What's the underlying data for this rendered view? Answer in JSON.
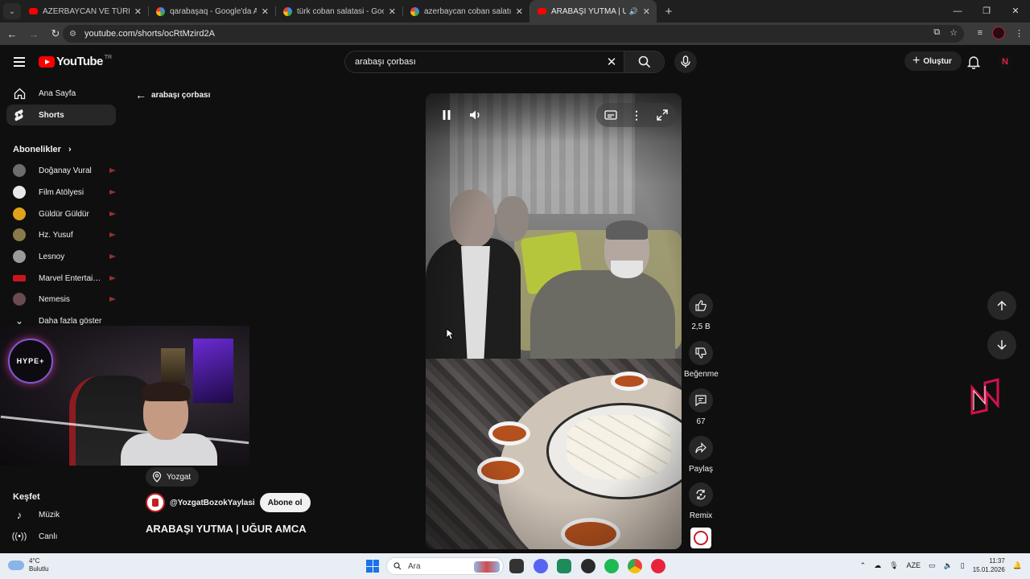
{
  "browser": {
    "tabs": [
      {
        "title": "AZERBAYCAN VE TÜRKİYE YEMEK",
        "favicon": "youtube"
      },
      {
        "title": "qarabaşaq - Google'da Ara",
        "favicon": "google"
      },
      {
        "title": "türk coban salatasi - Google'da",
        "favicon": "google"
      },
      {
        "title": "azerbaycan coban salatı - Google",
        "favicon": "google"
      },
      {
        "title": "ARABAŞI YUTMA | UĞUR AMCA",
        "favicon": "youtube",
        "active": true
      }
    ],
    "url": "youtube.com/shorts/ocRtMzird2A"
  },
  "header": {
    "logo_text": "YouTube",
    "country_code": "TR",
    "search_query": "arabaşı çorbası",
    "create_label": "Oluştur"
  },
  "sidebar": {
    "nav": [
      {
        "label": "Ana Sayfa",
        "icon": "home-icon"
      },
      {
        "label": "Shorts",
        "icon": "shorts-icon",
        "selected": true
      }
    ],
    "subscriptions_title": "Abonelikler",
    "subscriptions": [
      {
        "name": "Doğanay Vural",
        "color": "#6d6d6d"
      },
      {
        "name": "Film Atölyesi",
        "color": "#e8e8e8"
      },
      {
        "name": "Güldür Güldür",
        "color": "#e2a21b"
      },
      {
        "name": "Hz. Yusuf",
        "color": "#8a7a4a"
      },
      {
        "name": "Lesnoy",
        "color": "#9a9a9a"
      },
      {
        "name": "Marvel Entertainment",
        "color": "#c9161d"
      },
      {
        "name": "Nemesis",
        "color": "#6b4a52"
      }
    ],
    "show_more": "Daha fazla göster",
    "explore_title": "Keşfet",
    "explore": [
      {
        "label": "Müzik",
        "icon": "music-icon"
      },
      {
        "label": "Canlı",
        "icon": "live-icon"
      }
    ],
    "overlay_badge": "HYPE+"
  },
  "shorts": {
    "back_label": "arabaşı çorbası",
    "location": "Yozgat",
    "channel": "@YozgatBozokYaylasi",
    "subscribe_label": "Abone ol",
    "title": "ARABAŞI YUTMA | UĞUR AMCA",
    "actions": {
      "likes": "2,5 B",
      "dislike_label": "Beğenme",
      "comments": "67",
      "share_label": "Paylaş",
      "remix_label": "Remix"
    }
  },
  "taskbar": {
    "weather_temp": "4°C",
    "weather_desc": "Bulutlu",
    "search_placeholder": "Ara",
    "language": "AZE",
    "time": "11:37",
    "date": "15.01.2026"
  }
}
